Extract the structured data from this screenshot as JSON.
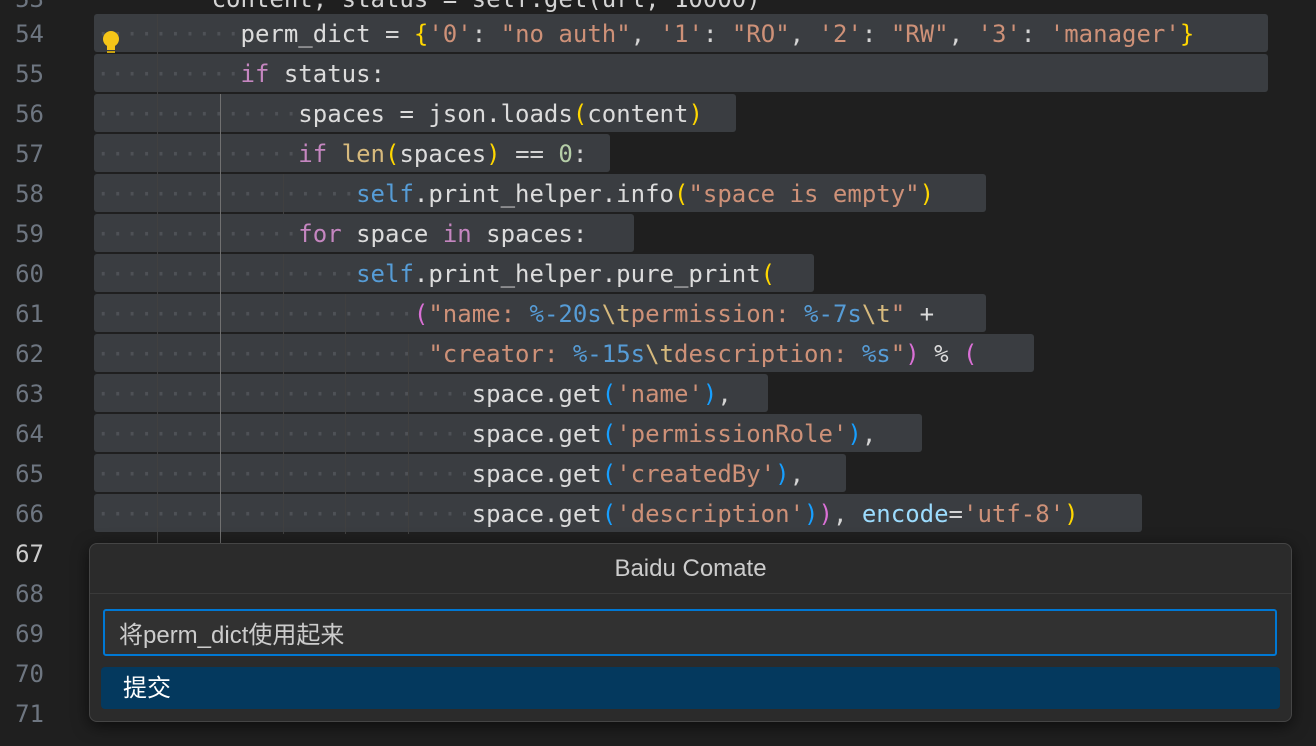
{
  "editor": {
    "top_partial_line": {
      "number": "53",
      "text": "        content, status = self.get(url, 10000)"
    },
    "current_line": "67",
    "lines": [
      {
        "number": "54"
      },
      {
        "number": "55"
      },
      {
        "number": "56"
      },
      {
        "number": "57"
      },
      {
        "number": "58"
      },
      {
        "number": "59"
      },
      {
        "number": "60"
      },
      {
        "number": "61"
      },
      {
        "number": "62"
      },
      {
        "number": "63"
      },
      {
        "number": "64"
      },
      {
        "number": "65"
      },
      {
        "number": "66"
      },
      {
        "number": "67"
      },
      {
        "number": "68"
      },
      {
        "number": "69"
      },
      {
        "number": "70"
      },
      {
        "number": "71"
      }
    ],
    "code": {
      "l54": [
        "perm_dict",
        " = ",
        "{",
        "'0'",
        ": ",
        "\"no auth\"",
        ", ",
        "'1'",
        ": ",
        "\"RO\"",
        ", ",
        "'2'",
        ": ",
        "\"RW\"",
        ", ",
        "'3'",
        ": ",
        "'manager'",
        "}"
      ],
      "l55": [
        "if",
        " status:"
      ],
      "l56": [
        "spaces = json.loads",
        "(",
        "content",
        ")"
      ],
      "l57": [
        "if",
        " ",
        "len",
        "(",
        "spaces",
        ")",
        " == ",
        "0",
        ":"
      ],
      "l58": [
        "self",
        ".print_helper.info",
        "(",
        "\"space is empty\"",
        ")"
      ],
      "l59": [
        "for",
        " space ",
        "in",
        " spaces:"
      ],
      "l60": [
        "self",
        ".print_helper.pure_print",
        "("
      ],
      "l61": [
        "(",
        "\"name: ",
        "%-20s",
        "\\t",
        "permission: ",
        "%-7s",
        "\\t",
        "\"",
        " +"
      ],
      "l62": [
        "\"creator: ",
        "%-15s",
        "\\t",
        "description: ",
        "%s",
        "\"",
        ")",
        " % ",
        "("
      ],
      "l63": [
        "space.get",
        "(",
        "'name'",
        ")",
        ","
      ],
      "l64": [
        "space.get",
        "(",
        "'permissionRole'",
        ")",
        ","
      ],
      "l65": [
        "space.get",
        "(",
        "'createdBy'",
        ")",
        ","
      ],
      "l66": [
        "space.get",
        "(",
        "'description'",
        ")",
        ")",
        ", ",
        "encode",
        "=",
        "'utf-8'",
        ")"
      ]
    }
  },
  "colors": {
    "background": "#1f1f1f",
    "selection": "#3a3d41",
    "dialog_background": "#2b2b2b",
    "input_border": "#0078d4",
    "option_highlight": "#04395e"
  },
  "icons": {
    "lightbulb": "lightbulb-icon"
  },
  "dialog": {
    "title": "Baidu Comate",
    "input_value": "将perm_dict使用起来",
    "submit_label": "提交"
  }
}
